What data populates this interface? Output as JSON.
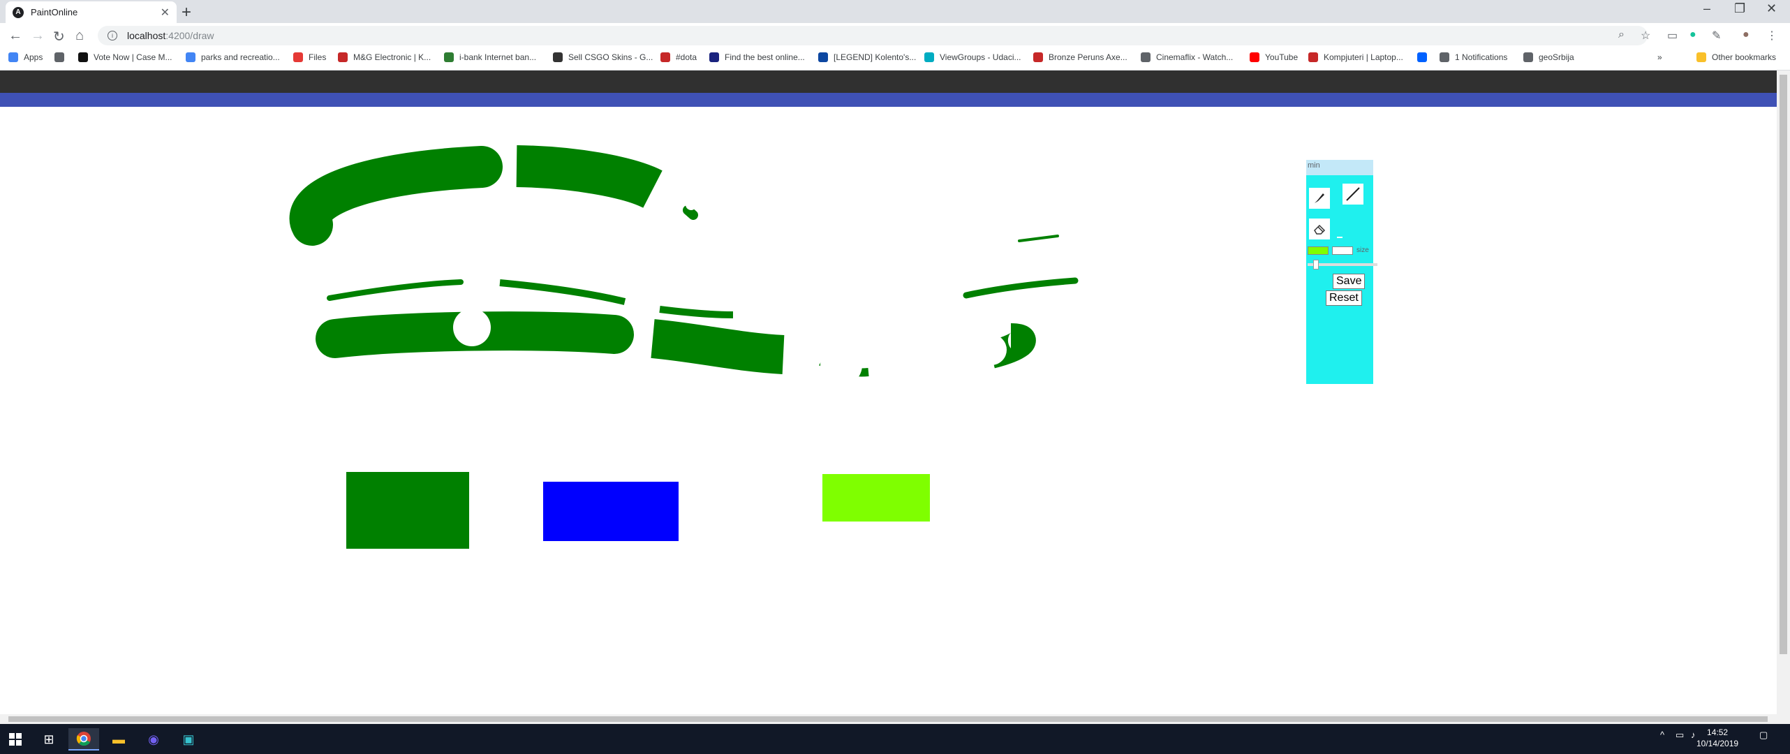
{
  "browser": {
    "tab_title": "PaintOnline",
    "tab_favicon": "A",
    "url_host": "localhost",
    "url_path": ":4200/draw"
  },
  "bookmarks": [
    {
      "label": "Apps",
      "icon": "apps-grid-icon",
      "color": "#4285f4"
    },
    {
      "label": "",
      "icon": "globe-icon",
      "color": "#5f6368"
    },
    {
      "label": "Vote Now | Case M...",
      "icon": "site-icon",
      "color": "#111111"
    },
    {
      "label": "parks and recreatio...",
      "icon": "google-icon",
      "color": "#4285f4"
    },
    {
      "label": "Files",
      "icon": "files-icon",
      "color": "#e53935"
    },
    {
      "label": "M&G Electronic | K...",
      "icon": "site-icon",
      "color": "#c62828"
    },
    {
      "label": "i-bank Internet ban...",
      "icon": "bank-icon",
      "color": "#2e7d32"
    },
    {
      "label": "Sell CSGO Skins - G...",
      "icon": "site-icon",
      "color": "#333333"
    },
    {
      "label": "#dota",
      "icon": "site-icon",
      "color": "#c62828"
    },
    {
      "label": "Find the best online...",
      "icon": "site-icon",
      "color": "#1a237e"
    },
    {
      "label": "[LEGEND] Kolento's...",
      "icon": "site-icon",
      "color": "#0d47a1"
    },
    {
      "label": "ViewGroups - Udaci...",
      "icon": "udacity-icon",
      "color": "#00acc1"
    },
    {
      "label": "Bronze Peruns Axe...",
      "icon": "site-icon",
      "color": "#c62828"
    },
    {
      "label": "Cinemaflix - Watch...",
      "icon": "globe-icon",
      "color": "#5f6368"
    },
    {
      "label": "YouTube",
      "icon": "youtube-icon",
      "color": "#ff0000"
    },
    {
      "label": "Kompjuteri | Laptop...",
      "icon": "kp-icon",
      "color": "#c62828"
    },
    {
      "label": "",
      "icon": "dropbox-icon",
      "color": "#0061ff"
    },
    {
      "label": "1 Notifications",
      "icon": "globe-icon",
      "color": "#5f6368"
    },
    {
      "label": "geoSrbija",
      "icon": "globe-icon",
      "color": "#5f6368"
    }
  ],
  "bookmarks_other": "Other bookmarks",
  "bookmarks_more": "»",
  "panel": {
    "min_label": "min",
    "size_label": "size",
    "save_label": "Save",
    "reset_label": "Reset",
    "stroke_color": "#7fff00",
    "fill_color": "#ffffff"
  },
  "drawing_colors": {
    "stroke_green": "#008000",
    "rect_blue": "#0000ff",
    "rect_lime": "#7fff00"
  },
  "taskbar": {
    "time": "14:52",
    "date": "10/14/2019"
  }
}
